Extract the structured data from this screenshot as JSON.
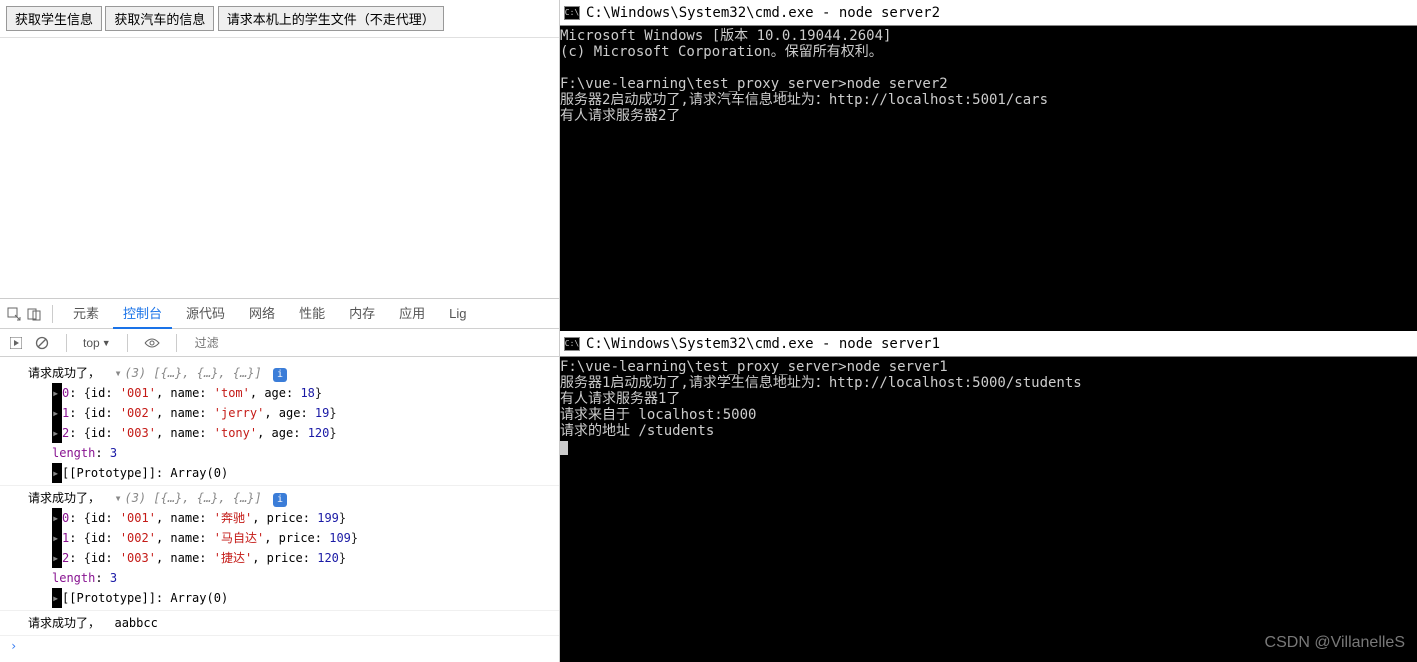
{
  "buttons": {
    "get_students": "获取学生信息",
    "get_cars": "获取汽车的信息",
    "get_local_file": "请求本机上的学生文件（不走代理）"
  },
  "devtools": {
    "tabs": {
      "elements": "元素",
      "console": "控制台",
      "sources": "源代码",
      "network": "网络",
      "performance": "性能",
      "memory": "内存",
      "application": "应用",
      "more": "Lig"
    },
    "subbar": {
      "context": "top",
      "filter_placeholder": "过滤"
    }
  },
  "console_logs": {
    "success_prefix": "请求成功了，",
    "arr_summary": "(3) [{…}, {…}, {…}]",
    "students": [
      {
        "idx": "0",
        "id": "001",
        "name": "tom",
        "age": "18"
      },
      {
        "idx": "1",
        "id": "002",
        "name": "jerry",
        "age": "19"
      },
      {
        "idx": "2",
        "id": "003",
        "name": "tony",
        "age": "120"
      }
    ],
    "length_label": "length",
    "length_val": "3",
    "proto_label": "[[Prototype]]",
    "proto_val": "Array(0)",
    "cars": [
      {
        "idx": "0",
        "id": "001",
        "name": "奔驰",
        "price": "199"
      },
      {
        "idx": "1",
        "id": "002",
        "name": "马自达",
        "price": "109"
      },
      {
        "idx": "2",
        "id": "003",
        "name": "捷达",
        "price": "120"
      }
    ],
    "plain_result": "aabbcc"
  },
  "terminals": {
    "top": {
      "title": "C:\\Windows\\System32\\cmd.exe - node  server2",
      "lines": [
        "Microsoft Windows [版本 10.0.19044.2604]",
        "(c) Microsoft Corporation。保留所有权利。",
        "",
        "F:\\vue-learning\\test_proxy_server>node server2",
        "服务器2启动成功了,请求汽车信息地址为：http://localhost:5001/cars",
        "有人请求服务器2了"
      ]
    },
    "bottom": {
      "title": "C:\\Windows\\System32\\cmd.exe - node  server1",
      "lines": [
        "F:\\vue-learning\\test_proxy_server>node server1",
        "服务器1启动成功了,请求学生信息地址为：http://localhost:5000/students",
        "有人请求服务器1了",
        "请求来自于 localhost:5000",
        "请求的地址 /students"
      ]
    }
  },
  "watermark": "CSDN @VillanelleS"
}
